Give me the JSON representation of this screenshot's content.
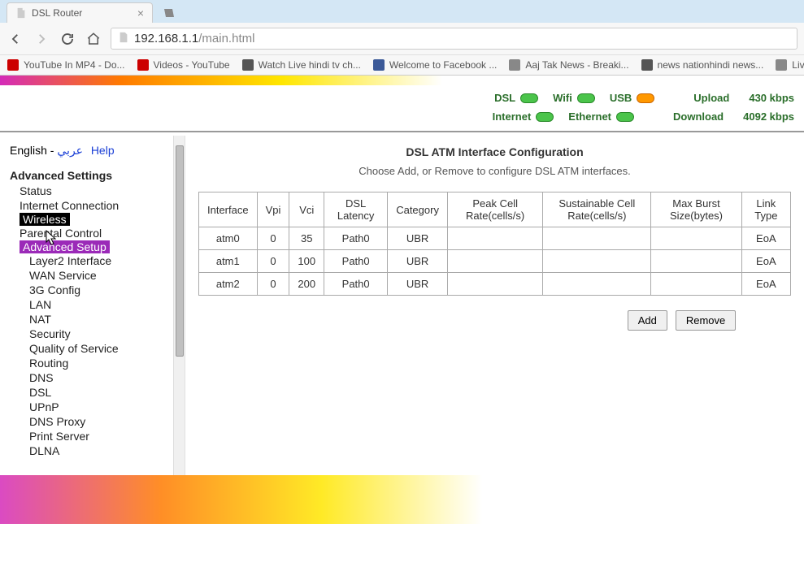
{
  "browser": {
    "tab_title": "DSL Router",
    "url_host": "192.168.1.1",
    "url_path": "/main.html",
    "bookmarks": [
      {
        "label": "YouTube In MP4 - Do...",
        "color": "#cc0000"
      },
      {
        "label": "Videos - YouTube",
        "color": "#cc0000"
      },
      {
        "label": "Watch Live hindi tv ch...",
        "color": "#555"
      },
      {
        "label": "Welcome to Facebook ...",
        "color": "#3b5998"
      },
      {
        "label": "Aaj Tak News - Breaki...",
        "color": "#888"
      },
      {
        "label": "news nationhindi news...",
        "color": "#555"
      },
      {
        "label": "Live Hindi News: Wa",
        "color": "#888"
      }
    ]
  },
  "status": {
    "row1": [
      {
        "label": "DSL",
        "pill": "green"
      },
      {
        "label": "Wifi",
        "pill": "green"
      },
      {
        "label": "USB",
        "pill": "orange"
      }
    ],
    "upload_label": "Upload",
    "upload_value": "430 kbps",
    "row2": [
      {
        "label": "Internet",
        "pill": "green"
      },
      {
        "label": "Ethernet",
        "pill": "green"
      }
    ],
    "download_label": "Download",
    "download_value": "4092 kbps"
  },
  "sidebar": {
    "lang_en": "English",
    "lang_sep": " - ",
    "lang_ar": "عربي",
    "help": "Help",
    "section": "Advanced Settings",
    "items": [
      {
        "label": "Status",
        "lvl": 1
      },
      {
        "label": "Internet Connection",
        "lvl": 1
      },
      {
        "label": "Wireless",
        "lvl": 1,
        "sel": "black"
      },
      {
        "label": "Parental Control",
        "lvl": 1
      },
      {
        "label": "Advanced Setup",
        "lvl": 1,
        "sel": "purple"
      },
      {
        "label": "Layer2 Interface",
        "lvl": 2
      },
      {
        "label": "WAN Service",
        "lvl": 2
      },
      {
        "label": "3G Config",
        "lvl": 2
      },
      {
        "label": "LAN",
        "lvl": 2
      },
      {
        "label": "NAT",
        "lvl": 2
      },
      {
        "label": "Security",
        "lvl": 2
      },
      {
        "label": "Quality of Service",
        "lvl": 2
      },
      {
        "label": "Routing",
        "lvl": 2
      },
      {
        "label": "DNS",
        "lvl": 2
      },
      {
        "label": "DSL",
        "lvl": 2
      },
      {
        "label": "UPnP",
        "lvl": 2
      },
      {
        "label": "DNS Proxy",
        "lvl": 2
      },
      {
        "label": "Print Server",
        "lvl": 2
      },
      {
        "label": "DLNA",
        "lvl": 2
      }
    ]
  },
  "content": {
    "title": "DSL ATM Interface Configuration",
    "subtitle": "Choose Add, or Remove to configure DSL ATM interfaces.",
    "headers": [
      "Interface",
      "Vpi",
      "Vci",
      "DSL Latency",
      "Category",
      "Peak Cell Rate(cells/s)",
      "Sustainable Cell Rate(cells/s)",
      "Max Burst Size(bytes)",
      "Link Type"
    ],
    "rows": [
      {
        "iface": "atm0",
        "vpi": "0",
        "vci": "35",
        "lat": "Path0",
        "cat": "UBR",
        "peak": "",
        "sust": "",
        "burst": "",
        "link": "EoA"
      },
      {
        "iface": "atm1",
        "vpi": "0",
        "vci": "100",
        "lat": "Path0",
        "cat": "UBR",
        "peak": "",
        "sust": "",
        "burst": "",
        "link": "EoA"
      },
      {
        "iface": "atm2",
        "vpi": "0",
        "vci": "200",
        "lat": "Path0",
        "cat": "UBR",
        "peak": "",
        "sust": "",
        "burst": "",
        "link": "EoA"
      }
    ],
    "add_btn": "Add",
    "remove_btn": "Remove"
  }
}
